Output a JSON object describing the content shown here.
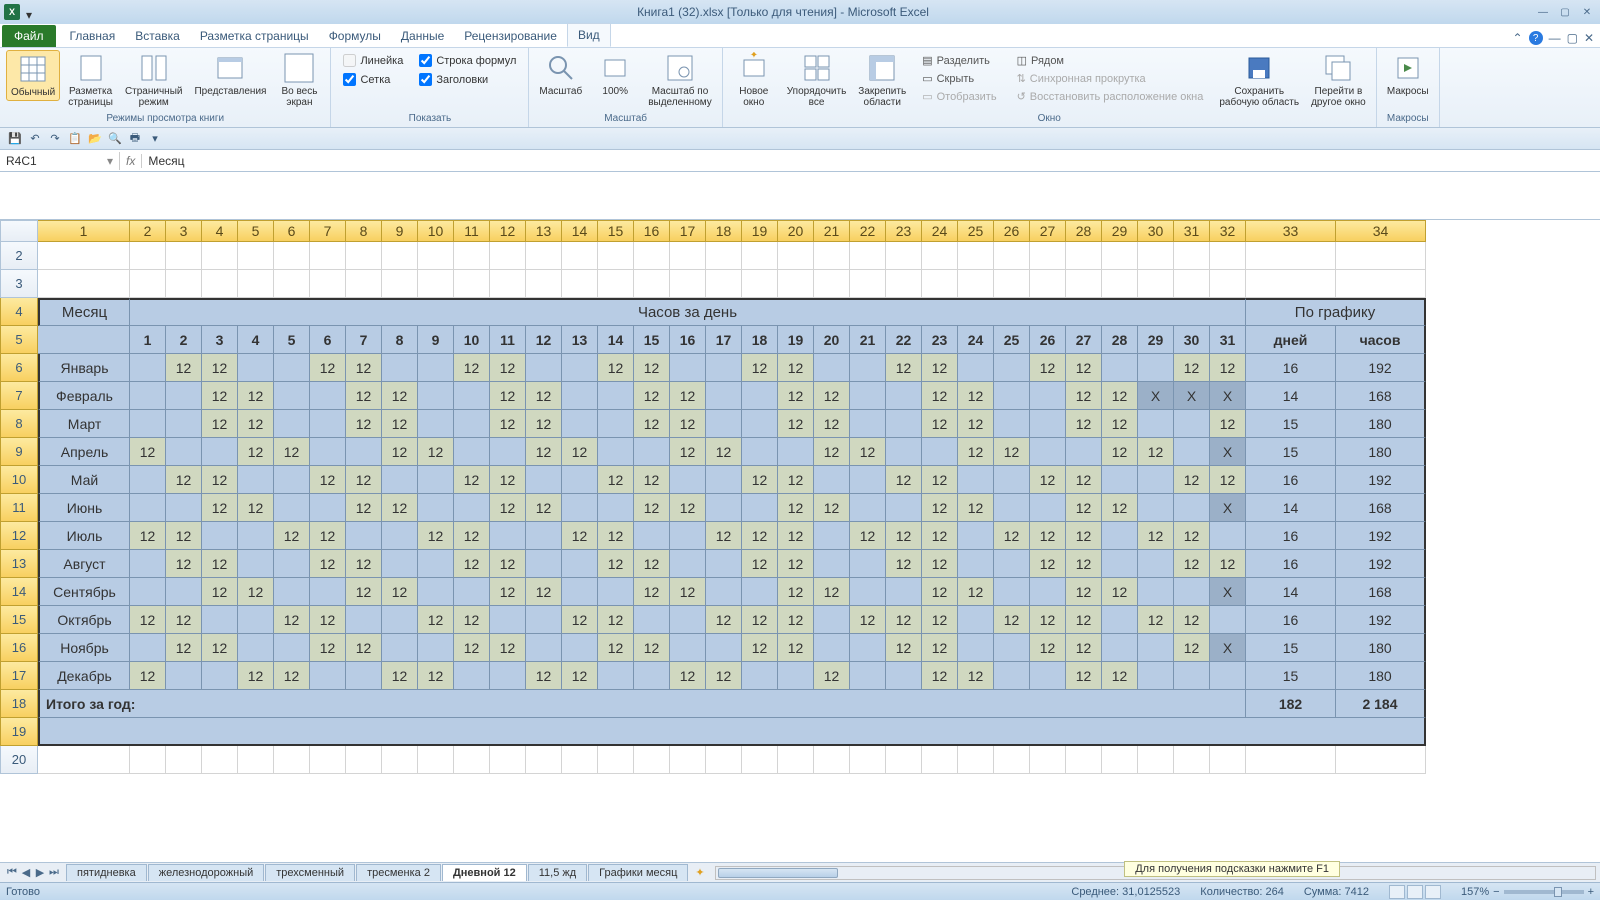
{
  "title": "Книга1 (32).xlsx  [Только для чтения]  -  Microsoft Excel",
  "ribbon_tabs": [
    "Главная",
    "Вставка",
    "Разметка страницы",
    "Формулы",
    "Данные",
    "Рецензирование",
    "Вид"
  ],
  "file_tab": "Файл",
  "ribbon": {
    "views": {
      "normal": "Обычный",
      "page_layout": "Разметка\nстраницы",
      "page_break": "Страничный\nрежим",
      "custom": "Представления",
      "fullscreen": "Во весь\nэкран",
      "group": "Режимы просмотра книги"
    },
    "show": {
      "ruler": "Линейка",
      "formula_bar": "Строка формул",
      "grid": "Сетка",
      "headings": "Заголовки",
      "group": "Показать"
    },
    "zoom": {
      "zoom": "Масштаб",
      "hundred": "100%",
      "to_sel": "Масштаб по\nвыделенному",
      "group": "Масштаб"
    },
    "window": {
      "new": "Новое\nокно",
      "arrange": "Упорядочить\nвсе",
      "freeze": "Закрепить\nобласти",
      "split": "Разделить",
      "hide": "Скрыть",
      "unhide": "Отобразить",
      "side": "Рядом",
      "sync": "Синхронная прокрутка",
      "reset": "Восстановить расположение окна",
      "save_ws": "Сохранить\nрабочую область",
      "switch": "Перейти в\nдругое окно",
      "group": "Окно"
    },
    "macros": {
      "macros": "Макросы",
      "group": "Макросы"
    }
  },
  "name_box": "R4C1",
  "formula_value": "Месяц",
  "col_headers": [
    "1",
    "2",
    "3",
    "4",
    "5",
    "6",
    "7",
    "8",
    "9",
    "10",
    "11",
    "12",
    "13",
    "14",
    "15",
    "16",
    "17",
    "18",
    "19",
    "20",
    "21",
    "22",
    "23",
    "24",
    "25",
    "26",
    "27",
    "28",
    "29",
    "30",
    "31",
    "32",
    "33",
    "34"
  ],
  "row_headers": [
    "2",
    "3",
    "4",
    "5",
    "6",
    "7",
    "8",
    "9",
    "10",
    "11",
    "12",
    "13",
    "14",
    "15",
    "16",
    "17",
    "18",
    "19",
    "20"
  ],
  "table": {
    "month_label": "Месяц",
    "hours_per_day": "Часов за день",
    "schedule": "По графику",
    "days_col": "дней",
    "hours_col": "часов",
    "day_numbers": [
      "1",
      "2",
      "3",
      "4",
      "5",
      "6",
      "7",
      "8",
      "9",
      "10",
      "11",
      "12",
      "13",
      "14",
      "15",
      "16",
      "17",
      "18",
      "19",
      "20",
      "21",
      "22",
      "23",
      "24",
      "25",
      "26",
      "27",
      "28",
      "29",
      "30",
      "31"
    ],
    "months": [
      {
        "name": "Январь",
        "days": [
          "",
          "12",
          "12",
          "",
          "",
          "12",
          "12",
          "",
          "",
          "12",
          "12",
          "",
          "",
          "12",
          "12",
          "",
          "",
          "12",
          "12",
          "",
          "",
          "12",
          "12",
          "",
          "",
          "12",
          "12",
          "",
          "",
          "12",
          "12"
        ],
        "d": "16",
        "h": "192"
      },
      {
        "name": "Февраль",
        "days": [
          "",
          "",
          "12",
          "12",
          "",
          "",
          "12",
          "12",
          "",
          "",
          "12",
          "12",
          "",
          "",
          "12",
          "12",
          "",
          "",
          "12",
          "12",
          "",
          "",
          "12",
          "12",
          "",
          "",
          "12",
          "12",
          "X",
          "X",
          "X"
        ],
        "d": "14",
        "h": "168"
      },
      {
        "name": "Март",
        "days": [
          "",
          "",
          "12",
          "12",
          "",
          "",
          "12",
          "12",
          "",
          "",
          "12",
          "12",
          "",
          "",
          "12",
          "12",
          "",
          "",
          "12",
          "12",
          "",
          "",
          "12",
          "12",
          "",
          "",
          "12",
          "12",
          "",
          "",
          "12"
        ],
        "d": "15",
        "h": "180"
      },
      {
        "name": "Апрель",
        "days": [
          "12",
          "",
          "",
          "12",
          "12",
          "",
          "",
          "12",
          "12",
          "",
          "",
          "12",
          "12",
          "",
          "",
          "12",
          "12",
          "",
          "",
          "12",
          "12",
          "",
          "",
          "12",
          "12",
          "",
          "",
          "12",
          "12",
          "",
          "X"
        ],
        "d": "15",
        "h": "180"
      },
      {
        "name": "Май",
        "days": [
          "",
          "12",
          "12",
          "",
          "",
          "12",
          "12",
          "",
          "",
          "12",
          "12",
          "",
          "",
          "12",
          "12",
          "",
          "",
          "12",
          "12",
          "",
          "",
          "12",
          "12",
          "",
          "",
          "12",
          "12",
          "",
          "",
          "12",
          "12"
        ],
        "d": "16",
        "h": "192"
      },
      {
        "name": "Июнь",
        "days": [
          "",
          "",
          "12",
          "12",
          "",
          "",
          "12",
          "12",
          "",
          "",
          "12",
          "12",
          "",
          "",
          "12",
          "12",
          "",
          "",
          "12",
          "12",
          "",
          "",
          "12",
          "12",
          "",
          "",
          "12",
          "12",
          "",
          "",
          "X"
        ],
        "d": "14",
        "h": "168"
      },
      {
        "name": "Июль",
        "days": [
          "12",
          "12",
          "",
          "",
          "12",
          "12",
          "",
          "",
          "12",
          "12",
          "",
          "",
          "12",
          "12",
          "",
          "",
          "12",
          "12",
          "12",
          "",
          "12",
          "12",
          "12",
          "",
          "12",
          "12",
          "12",
          "",
          "12",
          "12",
          ""
        ],
        "d": "16",
        "h": "192"
      },
      {
        "name": "Август",
        "days": [
          "",
          "12",
          "12",
          "",
          "",
          "12",
          "12",
          "",
          "",
          "12",
          "12",
          "",
          "",
          "12",
          "12",
          "",
          "",
          "12",
          "12",
          "",
          "",
          "12",
          "12",
          "",
          "",
          "12",
          "12",
          "",
          "",
          "12",
          "12"
        ],
        "d": "16",
        "h": "192"
      },
      {
        "name": "Сентябрь",
        "days": [
          "",
          "",
          "12",
          "12",
          "",
          "",
          "12",
          "12",
          "",
          "",
          "12",
          "12",
          "",
          "",
          "12",
          "12",
          "",
          "",
          "12",
          "12",
          "",
          "",
          "12",
          "12",
          "",
          "",
          "12",
          "12",
          "",
          "",
          "X"
        ],
        "d": "14",
        "h": "168"
      },
      {
        "name": "Октябрь",
        "days": [
          "12",
          "12",
          "",
          "",
          "12",
          "12",
          "",
          "",
          "12",
          "12",
          "",
          "",
          "12",
          "12",
          "",
          "",
          "12",
          "12",
          "12",
          "",
          "12",
          "12",
          "12",
          "",
          "12",
          "12",
          "12",
          "",
          "12",
          "12",
          ""
        ],
        "d": "16",
        "h": "192"
      },
      {
        "name": "Ноябрь",
        "days": [
          "",
          "12",
          "12",
          "",
          "",
          "12",
          "12",
          "",
          "",
          "12",
          "12",
          "",
          "",
          "12",
          "12",
          "",
          "",
          "12",
          "12",
          "",
          "",
          "12",
          "12",
          "",
          "",
          "12",
          "12",
          "",
          "",
          "12",
          "X"
        ],
        "d": "15",
        "h": "180"
      },
      {
        "name": "Декабрь",
        "days": [
          "12",
          "",
          "",
          "12",
          "12",
          "",
          "",
          "12",
          "12",
          "",
          "",
          "12",
          "12",
          "",
          "",
          "12",
          "12",
          "",
          "",
          "12",
          "",
          "",
          "12",
          "12",
          "",
          "",
          "12",
          "12",
          "",
          "",
          ""
        ],
        "d": "15",
        "h": "180"
      }
    ],
    "total_label": "Итого за год:",
    "total_days": "182",
    "total_hours": "2 184"
  },
  "sheet_tabs": [
    "пятидневка",
    "железнодорожный",
    "трехсменный",
    "тресменка 2",
    "Дневной 12",
    "11,5 жд",
    "Графики месяц"
  ],
  "active_sheet": "Дневной 12",
  "hint": "Для получения подсказки нажмите F1",
  "status": {
    "ready": "Готово",
    "avg": "Среднее: 31,0125523",
    "count": "Количество: 264",
    "sum": "Сумма: 7412",
    "zoom": "157%"
  }
}
